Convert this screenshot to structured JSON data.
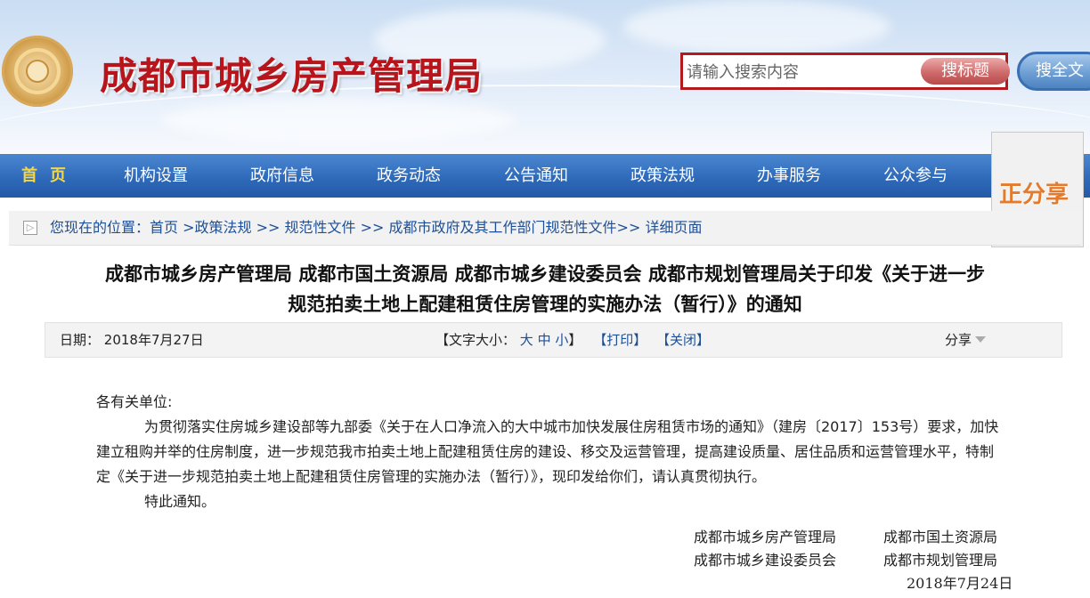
{
  "header": {
    "site_title": "成都市城乡房产管理局",
    "logo_icon": "city-emblem-icon",
    "search": {
      "placeholder": "请输入搜索内容",
      "value": "",
      "title_button": "搜标题",
      "fulltext_button": "搜全文"
    }
  },
  "nav": {
    "items": [
      "首页",
      "机构设置",
      "政府信息",
      "政务动态",
      "公告通知",
      "政策法规",
      "办事服务",
      "公众参与"
    ]
  },
  "share_widget": {
    "label": "正分享"
  },
  "breadcrumb": {
    "prefix": "您现在的位置：",
    "items": [
      "首页",
      "政策法规",
      "规范性文件",
      "成都市政府及其工作部门规范性文件",
      "详细页面"
    ],
    "separators": [
      " >",
      " >> ",
      " >> ",
      ">> "
    ]
  },
  "article": {
    "title_line1": "成都市城乡房产管理局 成都市国土资源局 成都市城乡建设委员会 成都市规划管理局关于印发《关于进一步",
    "title_line2": "规范拍卖土地上配建租赁住房管理的实施办法（暂行）》的通知",
    "meta": {
      "date_label": "日期：",
      "date_value": "2018年7月27日",
      "font_size_label": "【文字大小：",
      "font_sizes": [
        "大",
        "中",
        "小"
      ],
      "font_size_close": "】",
      "print": "【打印】",
      "close": "【关闭】",
      "share": "分享"
    },
    "salutation": "各有关单位:",
    "paragraph": "为贯彻落实住房城乡建设部等九部委《关于在人口净流入的大中城市加快发展住房租赁市场的通知》（建房〔2017〕153号）要求，加快建立租购并举的住房制度，进一步规范我市拍卖土地上配建租赁住房的建设、移交及运营管理，提高建设质量、居住品质和运营管理水平，特制定《关于进一步规范拍卖土地上配建租赁住房管理的实施办法（暂行）》，现印发给你们，请认真贯彻执行。",
    "notice": "特此通知。",
    "signatures": [
      "成都市城乡房产管理局",
      "成都市国土资源局",
      "成都市城乡建设委员会",
      "成都市规划管理局"
    ],
    "sign_date": "2018年7月24日"
  },
  "colors": {
    "title_red": "#b8141b",
    "nav_blue": "#2d68b8",
    "home_yellow": "#f3d64a",
    "link_blue": "#1e4f96",
    "share_orange": "#e37a2c"
  }
}
